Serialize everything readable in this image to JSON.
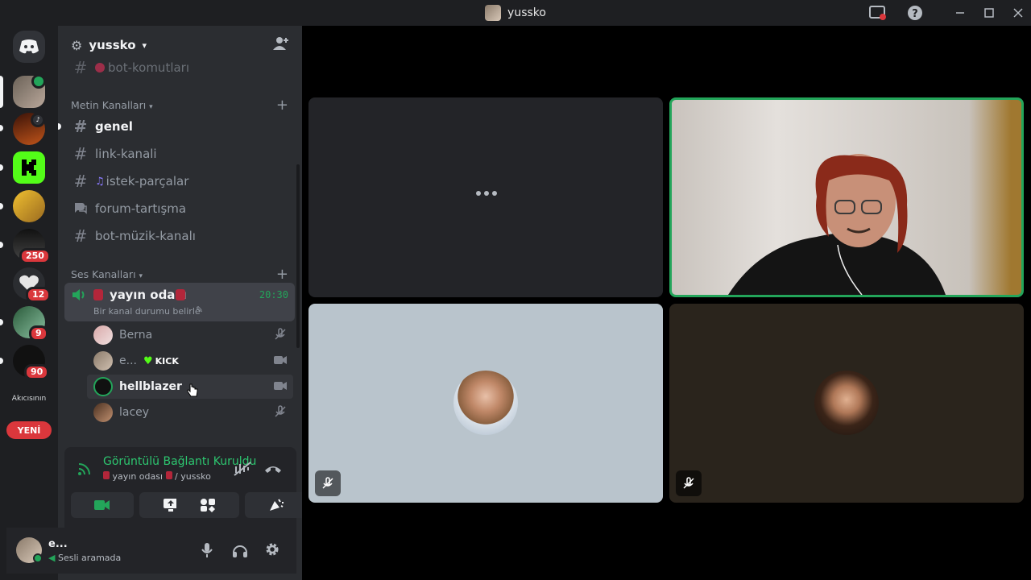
{
  "window": {
    "title": "yussko"
  },
  "server": {
    "name": "yussko",
    "partial_channel": "bot-komutları",
    "text_category": "Metin Kanalları",
    "text_channels": [
      {
        "name": "genel",
        "icon": "hash-icon"
      },
      {
        "name": "link-kanali",
        "icon": "hash-icon"
      },
      {
        "name": "istek-parçalar",
        "icon": "hash-icon"
      },
      {
        "name": "forum-tartışma",
        "icon": "forum-icon"
      },
      {
        "name": "bot-müzik-kanalı",
        "icon": "hash-icon"
      }
    ],
    "voice_category": "Ses Kanalları",
    "voice_channel": {
      "name": "yayın odası",
      "timer": "20:30",
      "status_placeholder": "Bir kanal durumu belirle"
    },
    "members": [
      {
        "name": "Berna",
        "status_icon": "muted-mic-icon"
      },
      {
        "name": "e...",
        "tag": "KICK",
        "status_icon": "camera-icon"
      },
      {
        "name": "hellblazer",
        "status_icon": "camera-icon"
      },
      {
        "name": "lacey",
        "status_icon": "muted-mic-icon"
      }
    ]
  },
  "rail": {
    "badges": [
      "250",
      "12",
      "9",
      "90"
    ],
    "text_server": "Akıcısının",
    "new_label": "YENİ"
  },
  "voice_panel": {
    "status": "Görüntülü Bağlantı Kuruldu",
    "channel": "yayın odası",
    "server": "/ yussko"
  },
  "user_panel": {
    "name": "e...",
    "status": "Sesli aramada"
  },
  "colors": {
    "accent_green": "#23a55a",
    "connected_text": "#2dc770",
    "badge_red": "#da373c",
    "tile_dark": "#232428",
    "tile_light": "#b9c4cc",
    "tile_brown": "#2a241c"
  }
}
